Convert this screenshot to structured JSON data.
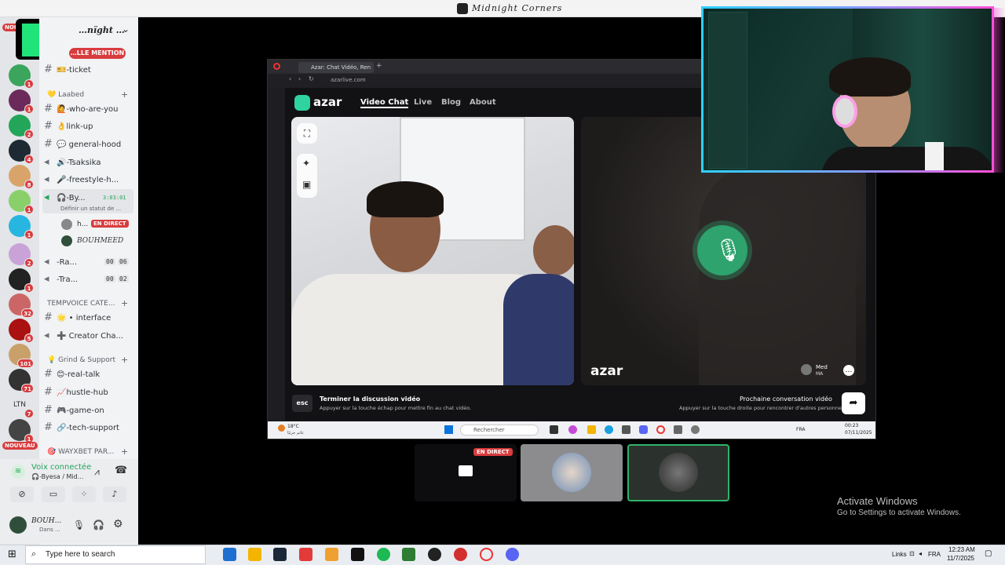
{
  "window_title": "Midnight Corners",
  "logo": {
    "text": "5"
  },
  "server": {
    "name": "…nïght …",
    "mention_badge": "…LLE MENTION"
  },
  "rail_badges": [
    "NOUV",
    "1",
    "1",
    "2",
    "4",
    "8",
    "1",
    "1",
    "2",
    "1",
    "32",
    "5",
    "101",
    "71",
    "7",
    "1",
    "NOUVEAU"
  ],
  "rail_label_ltn": "LTN",
  "channels": [
    {
      "icon": "#",
      "label": "🎫-ticket"
    },
    {
      "icon": "#",
      "label": "🙋-who-are-you"
    },
    {
      "icon": "#",
      "label": "👌link-up"
    },
    {
      "icon": "#",
      "label": "💬 general-hood"
    },
    {
      "icon": "🔊",
      "label": "🔊-Tsaksika"
    },
    {
      "icon": "🔊",
      "label": "🎤-freestyle-h..."
    },
    {
      "icon": "🔊",
      "label": "🎧-By...",
      "timer": "3:03:01",
      "sub": "Définir un statut de ..."
    },
    {
      "icon": "",
      "label": "h...",
      "badge": "EN DIRECT"
    },
    {
      "icon": "",
      "label": "BOUHMEED"
    },
    {
      "icon": "🔊",
      "label": "-Ra...",
      "a": "00",
      "b": "06"
    },
    {
      "icon": "🔊",
      "label": "-Tra...",
      "a": "00",
      "b": "02"
    },
    {
      "icon": "#",
      "label": "🌟 • interface"
    },
    {
      "icon": "🔊",
      "label": "➕ Creator Cha..."
    },
    {
      "icon": "#",
      "label": "😊-real-talk"
    },
    {
      "icon": "#",
      "label": "📈hustle-hub"
    },
    {
      "icon": "#",
      "label": "🎮-game-on"
    },
    {
      "icon": "#",
      "label": "🔗-tech-support"
    }
  ],
  "categories": [
    {
      "label": "💛 Laabed"
    },
    {
      "label": "TEMPVOICE CATE..."
    },
    {
      "label": "💡 Grind & Support"
    },
    {
      "label": "🎯 WAYXBET PAR..."
    }
  ],
  "voice": {
    "status": "Voix connectée",
    "sub": "🎧-Byesa / Mid..."
  },
  "user": {
    "name": "BOUH...",
    "status": "Dans ..."
  },
  "browser": {
    "tab_title": "Azar: Chat Vidéo, Ren",
    "url": "azarlive.com"
  },
  "azar": {
    "logo": "azar",
    "nav": [
      "Video Chat",
      "Live",
      "Blog",
      "About"
    ],
    "watermark": "azar",
    "peer_name": "Med",
    "peer_country": "MA",
    "end_title": "Terminer la discussion vidéo",
    "end_sub": "Appuyer sur la touche échap pour mettre fin au chat vidéo.",
    "esc": "esc",
    "next_title": "Prochaine conversation vidéo",
    "next_sub": "Appuyer sur la touche droite pour rencontrer d'autres personnes"
  },
  "inner_taskbar": {
    "weather": "18°C",
    "weather_sub": "غائم جزئيًا",
    "search": "Rechercher",
    "lang": "FRA",
    "time": "00:23",
    "date": "07/11/2025"
  },
  "stream": {
    "live_badge": "EN DIRECT"
  },
  "activate": {
    "title": "Activate Windows",
    "sub": "Go to Settings to activate Windows."
  },
  "taskbar": {
    "search": "Type here to search",
    "links": "Links",
    "lang": "FRA",
    "time": "12:23 AM",
    "date": "11/7/2025"
  },
  "colors": {
    "accent_green": "#2ea36e",
    "discord_red": "#d83c3e",
    "azar_teal": "#2fd3a0",
    "cam_border_pink": "#ff4fd8",
    "cam_border_cyan": "#2fd0ff"
  }
}
